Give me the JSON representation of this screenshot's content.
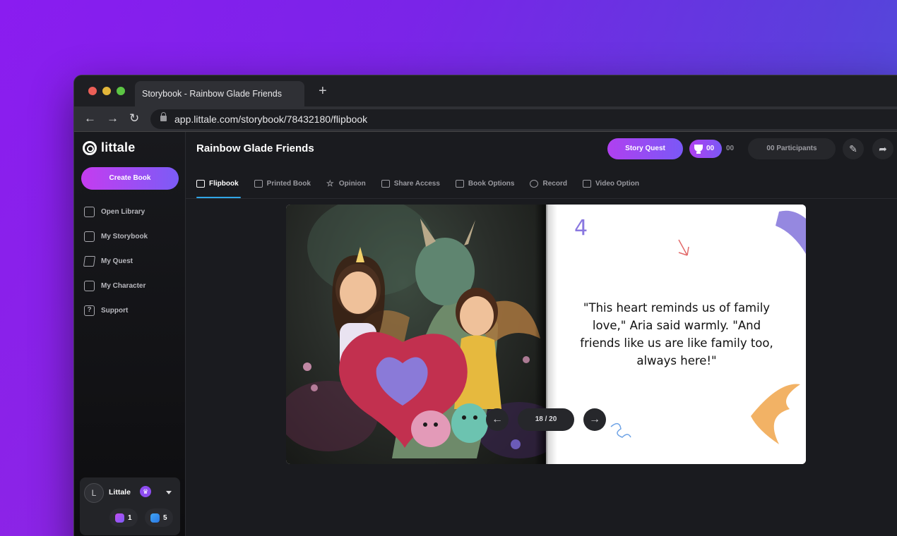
{
  "browser": {
    "tab_title": "Storybook - Rainbow Glade Friends",
    "url": "app.littale.com/storybook/78432180/flipbook"
  },
  "sidebar": {
    "logo": "littale",
    "create_label": "Create Book",
    "items": [
      {
        "label": "Open Library",
        "icon": "library-icon"
      },
      {
        "label": "My Storybook",
        "icon": "storybook-icon"
      },
      {
        "label": "My Quest",
        "icon": "graduation-cap-icon"
      },
      {
        "label": "My Character",
        "icon": "character-icon"
      },
      {
        "label": "Support",
        "icon": "help-icon"
      }
    ],
    "user": {
      "initial": "L",
      "name": "Littale",
      "credits": [
        {
          "value": "1",
          "icon": "book-credit-icon"
        },
        {
          "value": "5",
          "icon": "image-credit-icon"
        }
      ]
    }
  },
  "header": {
    "title": "Rainbow Glade Friends",
    "quest_label": "Story Quest",
    "score": "00",
    "score_secondary": "00",
    "participants": "00 Participants"
  },
  "tabs": [
    {
      "label": "Flipbook",
      "active": true,
      "icon": "flipbook-icon"
    },
    {
      "label": "Printed Book",
      "active": false,
      "icon": "printed-book-icon"
    },
    {
      "label": "Opinion",
      "active": false,
      "icon": "star-icon"
    },
    {
      "label": "Share Access",
      "active": false,
      "icon": "laptop-icon"
    },
    {
      "label": "Book Options",
      "active": false,
      "icon": "options-icon"
    },
    {
      "label": "Record",
      "active": false,
      "icon": "record-icon"
    },
    {
      "label": "Video Option",
      "active": false,
      "icon": "video-icon"
    }
  ],
  "book": {
    "page_number": "4",
    "text": "\"This heart reminds us of family love,\" Aria said warmly. \"And friends like us are like family too, always here!\""
  },
  "pagination": {
    "indicator": "18 / 20"
  },
  "colors": {
    "accent_gradient_start": "#c53cf0",
    "accent_gradient_end": "#7b5cf6",
    "active_tab_underline": "#31a6e6"
  }
}
